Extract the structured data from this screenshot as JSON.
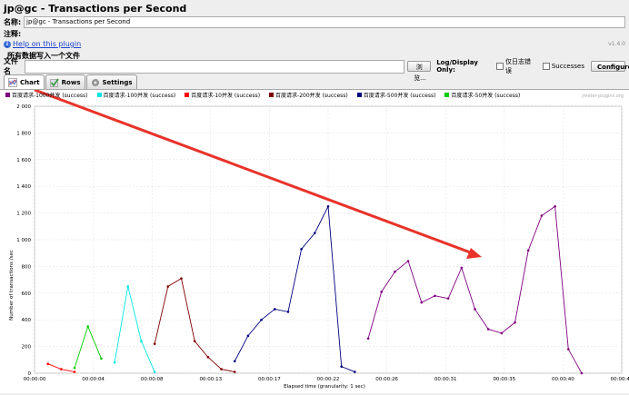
{
  "window": {
    "title": "jp@gc - Transactions per Second"
  },
  "name_field": {
    "label": "名称:",
    "value": "jp@gc - Transactions per Second"
  },
  "comment_field": {
    "label": "注释:",
    "value": ""
  },
  "help": {
    "link": "Help on this plugin",
    "version": "v1.4.0"
  },
  "write_all": {
    "label": "所有数据写入一个文件"
  },
  "file": {
    "label": "文件名",
    "value": "",
    "browse_label": "浏览...",
    "log_display_label": "Log/Display Only:",
    "errors_label": "仅日志错误",
    "successes_label": "Successes",
    "configure_label": "Configure"
  },
  "tabs": [
    {
      "label": "Chart",
      "icon": "chart-icon",
      "active": true
    },
    {
      "label": "Rows",
      "icon": "checkmark-icon",
      "active": false
    },
    {
      "label": "Settings",
      "icon": "gear-icon",
      "active": false
    }
  ],
  "brand": "jmeter-plugins.org",
  "chart_data": {
    "type": "line",
    "xlabel": "Elapsed time (granularity: 1 sec)",
    "ylabel": "Number of transactions /sec",
    "ylim": [
      0,
      2000
    ],
    "yticks": [
      "0",
      "200",
      "400",
      "600",
      "800",
      "1 000",
      "1 200",
      "1 400",
      "1 600",
      "1 800",
      "2 000"
    ],
    "xlim": [
      0,
      44
    ],
    "xticks": [
      "00:00:00",
      "00:00:04",
      "00:00:08",
      "00:00:13",
      "00:00:17",
      "00:00:22",
      "00:00:26",
      "00:00:31",
      "00:00:35",
      "00:00:40",
      "00:00:44"
    ],
    "xtick_values": [
      0,
      4.4,
      8.8,
      13.2,
      17.6,
      22,
      26.4,
      30.8,
      35.2,
      39.6,
      44
    ],
    "grid": true,
    "legend_position": "top",
    "series": [
      {
        "name": "百度请求-1000并发 (success)",
        "color": "#800080",
        "x": [
          25,
          26,
          27,
          28,
          29,
          30,
          31,
          32,
          33,
          34,
          35,
          36,
          37,
          38,
          39,
          40,
          41
        ],
        "y": [
          260,
          610,
          760,
          840,
          530,
          580,
          560,
          790,
          480,
          330,
          300,
          380,
          920,
          1180,
          1250,
          180,
          0
        ]
      },
      {
        "name": "百度请求-100并发 (success)",
        "color": "#00e5e5",
        "x": [
          6,
          7,
          8,
          9
        ],
        "y": [
          80,
          650,
          240,
          10
        ]
      },
      {
        "name": "百度请求-10并发 (success)",
        "color": "#ff0000",
        "x": [
          1,
          2,
          3
        ],
        "y": [
          70,
          30,
          10
        ]
      },
      {
        "name": "百度请求-200并发 (success)",
        "color": "#800000",
        "x": [
          9,
          10,
          11,
          12,
          13,
          14,
          15
        ],
        "y": [
          220,
          650,
          710,
          240,
          120,
          30,
          10
        ]
      },
      {
        "name": "百度请求-500并发 (success)",
        "color": "#000080",
        "x": [
          15,
          16,
          17,
          18,
          19,
          20,
          21,
          22,
          23,
          24
        ],
        "y": [
          90,
          280,
          400,
          480,
          460,
          930,
          1050,
          1250,
          50,
          10
        ]
      },
      {
        "name": "百度请求-50并发 (success)",
        "color": "#00cc00",
        "x": [
          3,
          4,
          5
        ],
        "y": [
          40,
          350,
          110
        ]
      }
    ]
  }
}
